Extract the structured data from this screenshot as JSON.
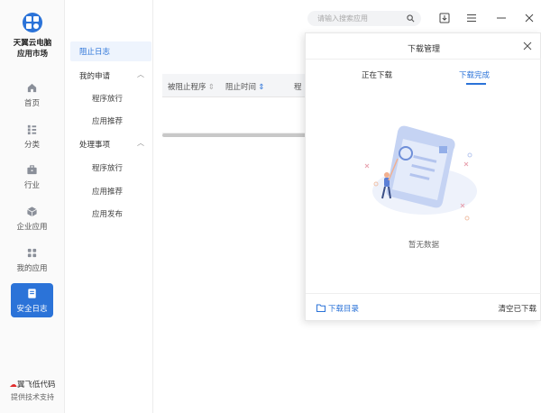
{
  "app": {
    "name_line1": "天翼云电脑",
    "name_line2": "应用市场",
    "accent": "#2b73d8"
  },
  "sidebar": {
    "items": [
      {
        "label": "首页",
        "icon": "home-icon"
      },
      {
        "label": "分类",
        "icon": "category-icon"
      },
      {
        "label": "行业",
        "icon": "briefcase-icon"
      },
      {
        "label": "企业应用",
        "icon": "cube-icon"
      },
      {
        "label": "我的应用",
        "icon": "apps-grid-icon"
      },
      {
        "label": "安全日志",
        "icon": "log-icon",
        "active": true
      }
    ],
    "brand": "翼飞",
    "brand_suffix": "低代码",
    "support": "提供技术支持"
  },
  "subnav": {
    "active": "阻止日志",
    "group1": "我的申请",
    "group1_items": [
      "程序放行",
      "应用推荐"
    ],
    "group2": "处理事项",
    "group2_items": [
      "程序放行",
      "应用推荐",
      "应用发布"
    ]
  },
  "table": {
    "columns": [
      "被阻止程序",
      "阻止时间",
      "程"
    ]
  },
  "search": {
    "placeholder": "请输入搜索应用"
  },
  "panel": {
    "title": "下载管理",
    "tabs": [
      "正在下载",
      "下载完成"
    ],
    "active_tab": 1,
    "empty_text": "暂无数据",
    "download_dir": "下载目录",
    "clear": "清空已下载"
  }
}
